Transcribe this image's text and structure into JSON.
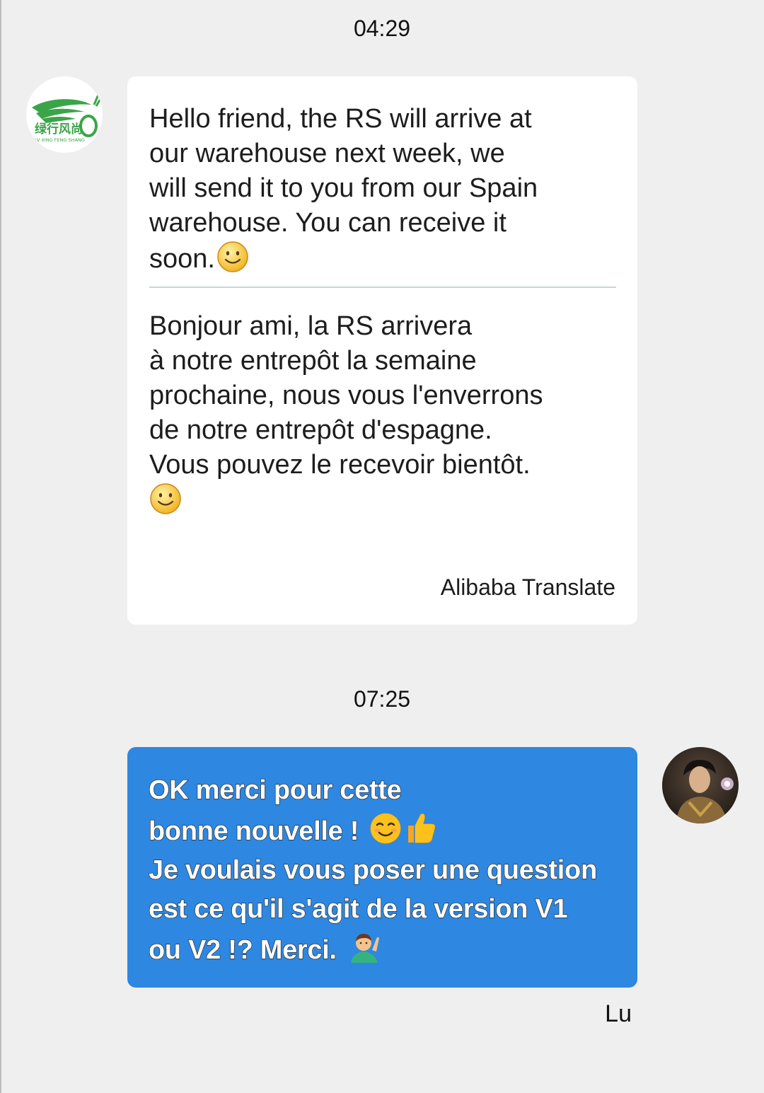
{
  "conversation": {
    "messages": [
      {
        "timestamp": "04:29",
        "sender_avatar": "seller-logo-avatar",
        "logo_text": "LV XING FENG SHANG",
        "original_text": "Hello friend, the RS will arrive at\nour warehouse next week, we\nwill send it to you from our Spain\nwarehouse. You can receive it\nsoon.",
        "translated_text": "Bonjour ami, la RS arrivera\nà notre entrepôt la semaine\nprochaine, nous vous l'enverrons\nde notre entrepôt d'espagne.\nVous pouvez le recevoir bientôt.",
        "translation_credit": "Alibaba Translate",
        "emoji": "smile-emoji"
      },
      {
        "timestamp": "07:25",
        "sender_avatar": "user-photo-avatar",
        "text_line_1": "OK merci pour cette",
        "text_line_2": "bonne nouvelle ! ",
        "text_line_3": "Je voulais vous poser une question",
        "text_line_4": "est ce qu'il s'agit de la version V1",
        "text_line_5": "ou  V2 !?  Merci. ",
        "sender_name": "Lu"
      }
    ]
  },
  "colors": {
    "background": "#efefef",
    "incoming_bubble": "#ffffff",
    "outgoing_bubble": "#2e87e0",
    "logo_green": "#3aa548"
  }
}
